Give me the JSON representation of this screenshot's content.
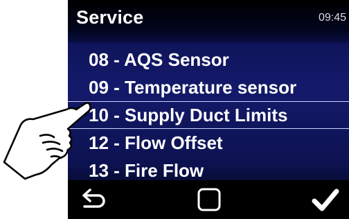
{
  "header": {
    "title": "Service",
    "time": "09:45"
  },
  "menu": {
    "items": [
      {
        "label": "08 - AQS Sensor",
        "selected": false
      },
      {
        "label": "09 - Temperature sensor",
        "selected": false
      },
      {
        "label": "10 - Supply Duct Limits",
        "selected": true
      },
      {
        "label": "12 - Flow Offset",
        "selected": false
      },
      {
        "label": "13 - Fire Flow",
        "selected": false
      }
    ]
  },
  "footer": {
    "back_icon": "back-arrow-icon",
    "home_icon": "square-icon",
    "confirm_icon": "checkmark-icon"
  },
  "overlay": {
    "pointer_icon": "pointing-hand-icon"
  }
}
